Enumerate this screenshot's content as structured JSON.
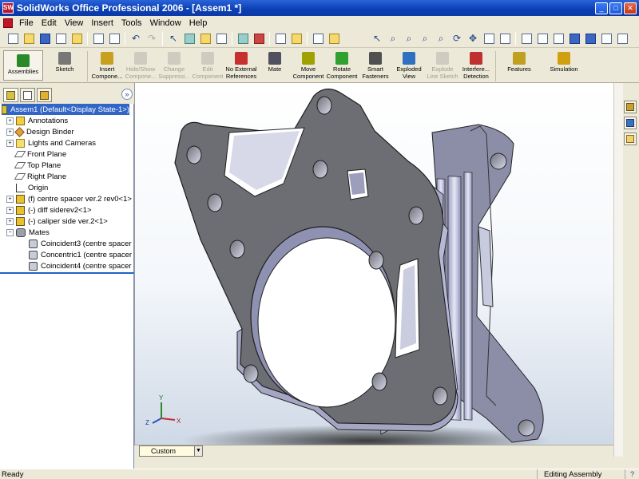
{
  "window": {
    "title": "SolidWorks Office Professional 2006 - [Assem1 *]",
    "app_icon_text": "SW",
    "min_glyph": "_",
    "max_glyph": "□",
    "close_glyph": "✕"
  },
  "menu": [
    "File",
    "Edit",
    "View",
    "Insert",
    "Tools",
    "Window",
    "Help"
  ],
  "command_manager": [
    {
      "label": "Assemblies",
      "enabled": true,
      "color": "#2a8a2a"
    },
    {
      "label": "Sketch",
      "enabled": true,
      "color": "#666666"
    },
    {
      "label": "Insert\nCompone...",
      "enabled": true,
      "color": "#c8a020"
    },
    {
      "label": "Hide/Show\nCompone...",
      "enabled": false,
      "color": "#999999"
    },
    {
      "label": "Change\nSuppressi...",
      "enabled": false,
      "color": "#999999"
    },
    {
      "label": "Edit\nComponent",
      "enabled": false,
      "color": "#999999"
    },
    {
      "label": "No External\nReferences",
      "enabled": true,
      "color": "#c83030"
    },
    {
      "label": "Mate",
      "enabled": true,
      "color": "#505060"
    },
    {
      "label": "Move\nComponent",
      "enabled": true,
      "color": "#a0a000"
    },
    {
      "label": "Rotate\nComponent",
      "enabled": true,
      "color": "#30a030"
    },
    {
      "label": "Smart\nFasteners",
      "enabled": true,
      "color": "#505050"
    },
    {
      "label": "Exploded\nView",
      "enabled": true,
      "color": "#3070c0"
    },
    {
      "label": "Explode\nLine Sketch",
      "enabled": false,
      "color": "#999999"
    },
    {
      "label": "Interfere...\nDetection",
      "enabled": true,
      "color": "#c03030"
    },
    {
      "label": "Features",
      "enabled": true,
      "color": "#c0a020"
    },
    {
      "label": "Simulation",
      "enabled": true,
      "color": "#d0a010"
    }
  ],
  "feature_tree": [
    {
      "label": "Assem1  (Default<Display State-1>)",
      "indent": 0,
      "expander": "",
      "icon": "asm",
      "selected": true
    },
    {
      "label": "Annotations",
      "indent": 1,
      "expander": "+",
      "icon": "ann",
      "selected": false
    },
    {
      "label": "Design Binder",
      "indent": 1,
      "expander": "+",
      "icon": "db",
      "selected": false
    },
    {
      "label": "Lights and Cameras",
      "indent": 1,
      "expander": "+",
      "icon": "lc",
      "selected": false
    },
    {
      "label": "Front Plane",
      "indent": 1,
      "expander": "",
      "icon": "pl",
      "selected": false
    },
    {
      "label": "Top Plane",
      "indent": 1,
      "expander": "",
      "icon": "pl",
      "selected": false
    },
    {
      "label": "Right Plane",
      "indent": 1,
      "expander": "",
      "icon": "pl",
      "selected": false
    },
    {
      "label": "Origin",
      "indent": 1,
      "expander": "",
      "icon": "or",
      "selected": false
    },
    {
      "label": "(f) centre spacer ver.2 rev0<1>",
      "indent": 1,
      "expander": "+",
      "icon": "part",
      "selected": false
    },
    {
      "label": "(-) diff siderev2<1>",
      "indent": 1,
      "expander": "+",
      "icon": "part",
      "selected": false
    },
    {
      "label": "(-) caliper side ver.2<1>",
      "indent": 1,
      "expander": "+",
      "icon": "part",
      "selected": false
    },
    {
      "label": "Mates",
      "indent": 1,
      "expander": "−",
      "icon": "mt",
      "selected": false
    },
    {
      "label": "Coincident3 (centre spacer ver",
      "indent": 2,
      "expander": "",
      "icon": "mate",
      "selected": false
    },
    {
      "label": "Concentric1 (centre spacer ver",
      "indent": 2,
      "expander": "",
      "icon": "mate",
      "selected": false
    },
    {
      "label": "Coincident4 (centre spacer ver",
      "indent": 2,
      "expander": "",
      "icon": "mate",
      "selected": false
    }
  ],
  "triad": {
    "x": "X",
    "y": "Y",
    "z": "Z"
  },
  "config_tab": {
    "value": "Custom"
  },
  "status": {
    "left": "Ready",
    "mode": "Editing Assembly",
    "help": "?"
  },
  "collapse_glyph": "»"
}
